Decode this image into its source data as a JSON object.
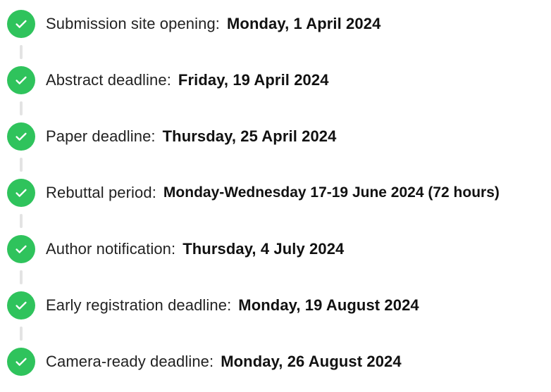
{
  "theme": {
    "accent": "#2fc35c",
    "connector": "#e3e3e3",
    "text": "#222222"
  },
  "steps": [
    {
      "label": "Submission site opening:",
      "date": "Monday, 1 April 2024",
      "icon": "check-circle-icon",
      "status": "completed"
    },
    {
      "label": "Abstract deadline:",
      "date": "Friday, 19 April 2024",
      "icon": "check-circle-icon",
      "status": "completed"
    },
    {
      "label": "Paper deadline:",
      "date": "Thursday, 25 April 2024",
      "icon": "check-circle-icon",
      "status": "completed"
    },
    {
      "label": "Rebuttal period:",
      "date": "Monday-Wednesday 17-19 June 2024 (72 hours)",
      "icon": "check-circle-icon",
      "status": "completed"
    },
    {
      "label": "Author notification:",
      "date": "Thursday, 4 July 2024",
      "icon": "check-circle-icon",
      "status": "completed"
    },
    {
      "label": "Early registration deadline:",
      "date": "Monday, 19 August 2024",
      "icon": "check-circle-icon",
      "status": "completed"
    },
    {
      "label": "Camera-ready deadline:",
      "date": "Monday, 26 August 2024",
      "icon": "check-circle-icon",
      "status": "completed"
    }
  ]
}
